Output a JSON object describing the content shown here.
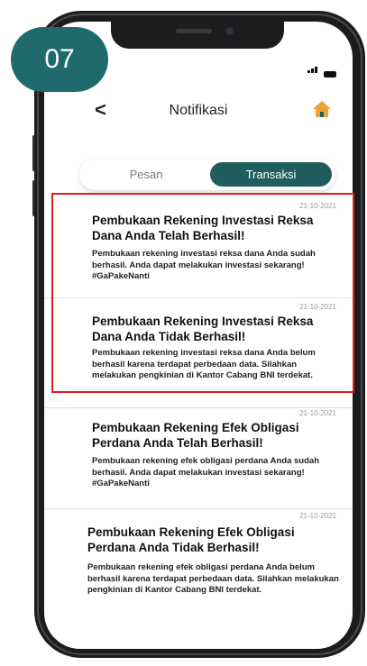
{
  "badge": "07",
  "header": {
    "back": "<",
    "title": "Notifikasi"
  },
  "tabs": [
    {
      "label": "Pesan",
      "selected": false
    },
    {
      "label": "Transaksi",
      "selected": true
    }
  ],
  "notifications": [
    {
      "date": "21-10-2021",
      "title": "Pembukaan Rekening Investasi Reksa Dana Anda Telah Berhasil!",
      "body": "Pembukaan rekening investasi reksa dana Anda sudah berhasil. Anda dapat melakukan investasi sekarang! #GaPakeNanti"
    },
    {
      "date": "21-10-2021",
      "title": "Pembukaan Rekening Investasi Reksa Dana Anda Tidak Berhasil!",
      "body": "Pembukaan rekening investasi reksa dana Anda belum berhasil karena terdapat perbedaan data. Silahkan melakukan pengkinian di Kantor Cabang BNI terdekat."
    },
    {
      "date": "21-10-2021",
      "title": "Pembukaan Rekening Efek Obligasi Perdana Anda Telah Berhasil!",
      "body": "Pembukaan rekening efek obligasi perdana Anda sudah berhasil. Anda dapat melakukan investasi sekarang! #GaPakeNanti"
    },
    {
      "date": "21-10-2021",
      "title": "Pembukaan Rekening Efek Obligasi Perdana Anda Tidak Berhasil!",
      "body": "Pembukaan rekening efek obligasi perdana Anda belum berhasil karena terdapat perbedaan data. Silahkan melakukan pengkinian di Kantor Cabang BNI terdekat."
    }
  ],
  "colors": {
    "accent": "#1f5d5e",
    "home": "#f0a23a",
    "highlight": "#e51d1d"
  }
}
